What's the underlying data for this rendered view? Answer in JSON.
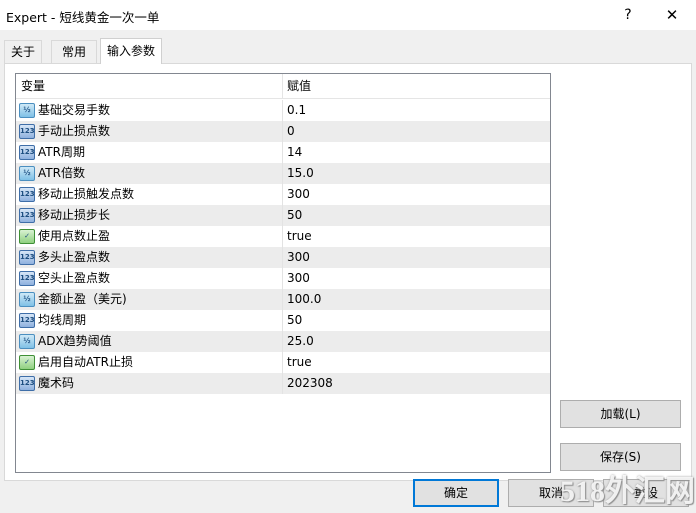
{
  "window": {
    "title": "Expert - 短线黄金一次一单",
    "help_label": "?",
    "close_label": "✕"
  },
  "tabs": [
    {
      "label": "关于",
      "active": false
    },
    {
      "label": "常用",
      "active": false
    },
    {
      "label": "输入参数",
      "active": true
    }
  ],
  "grid": {
    "headers": {
      "variable": "变量",
      "value": "赋值"
    },
    "rows": [
      {
        "type": "double",
        "icon": "double-type-icon",
        "name": "基础交易手数",
        "value": "0.1"
      },
      {
        "type": "int",
        "icon": "integer-type-icon",
        "name": "手动止损点数",
        "value": "0"
      },
      {
        "type": "int",
        "icon": "integer-type-icon",
        "name": "ATR周期",
        "value": "14"
      },
      {
        "type": "double",
        "icon": "double-type-icon",
        "name": "ATR倍数",
        "value": "15.0"
      },
      {
        "type": "int",
        "icon": "integer-type-icon",
        "name": "移动止损触发点数",
        "value": "300"
      },
      {
        "type": "int",
        "icon": "integer-type-icon",
        "name": "移动止损步长",
        "value": "50"
      },
      {
        "type": "bool",
        "icon": "boolean-type-icon",
        "name": "使用点数止盈",
        "value": "true"
      },
      {
        "type": "int",
        "icon": "integer-type-icon",
        "name": "多头止盈点数",
        "value": "300"
      },
      {
        "type": "int",
        "icon": "integer-type-icon",
        "name": "空头止盈点数",
        "value": "300"
      },
      {
        "type": "double",
        "icon": "double-type-icon",
        "name": "金额止盈（美元)",
        "value": "100.0"
      },
      {
        "type": "int",
        "icon": "integer-type-icon",
        "name": "均线周期",
        "value": "50"
      },
      {
        "type": "double",
        "icon": "double-type-icon",
        "name": "ADX趋势阈值",
        "value": "25.0"
      },
      {
        "type": "bool",
        "icon": "boolean-type-icon",
        "name": "启用自动ATR止损",
        "value": "true"
      },
      {
        "type": "int",
        "icon": "integer-type-icon",
        "name": "魔术码",
        "value": "202308"
      }
    ]
  },
  "buttons": {
    "load": "加载(L)",
    "save": "保存(S)",
    "ok": "确定",
    "cancel": "取消",
    "reset": "重设"
  },
  "icon_glyphs": {
    "double": "½",
    "int": "123",
    "bool": "✓"
  },
  "watermark": "518外汇网"
}
